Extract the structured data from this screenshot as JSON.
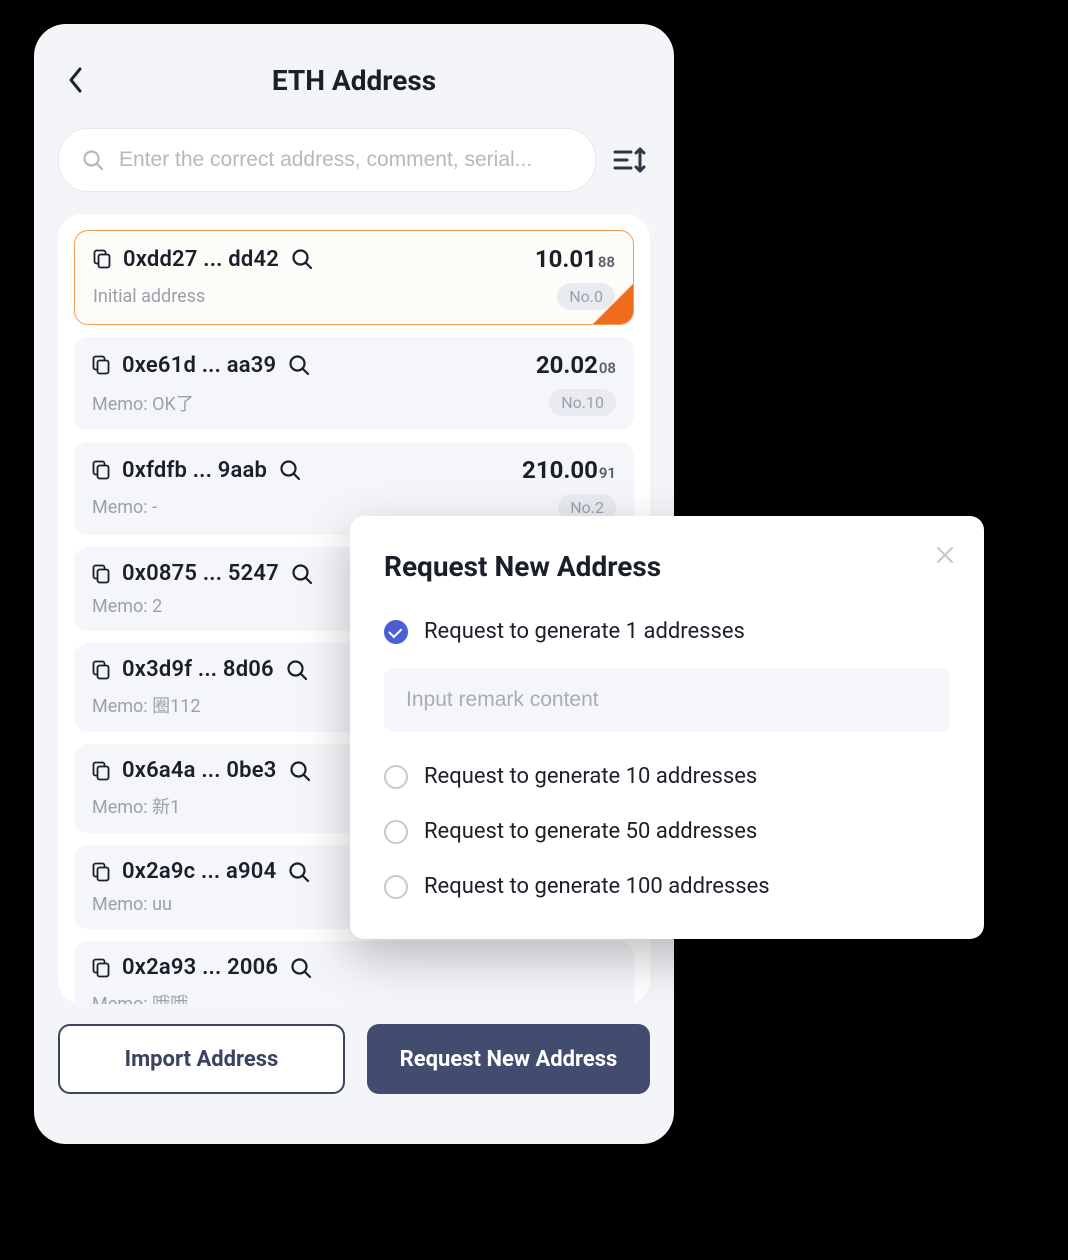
{
  "header": {
    "title": "ETH Address"
  },
  "search": {
    "placeholder": "Enter the correct address, comment, serial..."
  },
  "addresses": [
    {
      "addr": "0xdd27 ... dd42",
      "balance": "10.01",
      "balance_sub": "88",
      "memo": "Initial address",
      "no": "No.0",
      "selected": true
    },
    {
      "addr": "0xe61d ... aa39",
      "balance": "20.02",
      "balance_sub": "08",
      "memo": "Memo: OK了",
      "no": "No.10",
      "selected": false
    },
    {
      "addr": "0xfdfb ... 9aab",
      "balance": "210.00",
      "balance_sub": "91",
      "memo": "Memo: -",
      "no": "No.2",
      "selected": false
    },
    {
      "addr": "0x0875 ... 5247",
      "balance": "",
      "balance_sub": "",
      "memo": "Memo: 2",
      "no": "",
      "selected": false
    },
    {
      "addr": "0x3d9f ... 8d06",
      "balance": "",
      "balance_sub": "",
      "memo": "Memo: 圈112",
      "no": "",
      "selected": false
    },
    {
      "addr": "0x6a4a ... 0be3",
      "balance": "",
      "balance_sub": "",
      "memo": "Memo: 新1",
      "no": "",
      "selected": false
    },
    {
      "addr": "0x2a9c ... a904",
      "balance": "",
      "balance_sub": "",
      "memo": "Memo: uu",
      "no": "",
      "selected": false
    },
    {
      "addr": "0x2a93 ... 2006",
      "balance": "",
      "balance_sub": "",
      "memo": "Memo: 哦哦",
      "no": "",
      "selected": false
    }
  ],
  "footer": {
    "import_label": "Import Address",
    "request_label": "Request New Address"
  },
  "modal": {
    "title": "Request New Address",
    "remark_placeholder": "Input remark content",
    "options": [
      {
        "label": "Request to generate 1 addresses",
        "checked": true,
        "show_remark": true
      },
      {
        "label": "Request to generate 10 addresses",
        "checked": false,
        "show_remark": false
      },
      {
        "label": "Request to generate 50 addresses",
        "checked": false,
        "show_remark": false
      },
      {
        "label": "Request to generate 100 addresses",
        "checked": false,
        "show_remark": false
      }
    ]
  }
}
